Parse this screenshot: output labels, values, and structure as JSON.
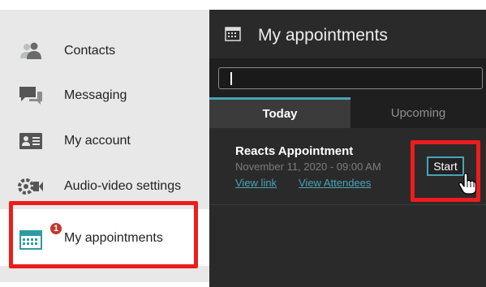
{
  "sidebar": {
    "items": [
      {
        "label": "Contacts",
        "icon": "contacts-icon"
      },
      {
        "label": "Messaging",
        "icon": "messaging-icon"
      },
      {
        "label": "My account",
        "icon": "account-card-icon"
      },
      {
        "label": "Audio-video settings",
        "icon": "audio-video-icon"
      },
      {
        "label": "My appointments",
        "icon": "calendar-icon",
        "badge": "1",
        "active": true
      }
    ]
  },
  "panel": {
    "title": "My appointments",
    "search": {
      "value": "",
      "placeholder": ""
    },
    "tabs": [
      {
        "label": "Today",
        "active": true
      },
      {
        "label": "Upcoming",
        "active": false
      }
    ],
    "appointments": [
      {
        "title": "Reacts Appointment",
        "date": "November 11, 2020 - 09:00 AM",
        "view_link": "View link",
        "view_attendees": "View Attendees",
        "start_label": "Start"
      }
    ]
  },
  "colors": {
    "accent": "#4aa3b5",
    "highlight": "#ee1c1c",
    "badge": "#c0392b",
    "panel_bg": "#2a2a2a"
  }
}
